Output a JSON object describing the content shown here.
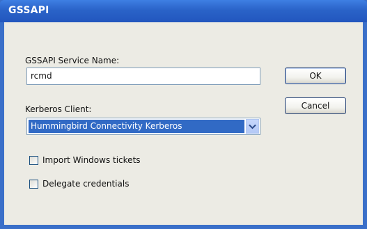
{
  "window": {
    "title": "GSSAPI"
  },
  "service_name": {
    "label": "GSSAPI Service Name:",
    "value": "rcmd"
  },
  "kerberos_client": {
    "label": "Kerberos Client:",
    "selected": "Hummingbird Connectivity Kerberos"
  },
  "buttons": {
    "ok_label": "OK",
    "cancel_label": "Cancel"
  },
  "options": {
    "import_tickets_label": "Import Windows tickets",
    "import_tickets_checked": false,
    "delegate_label": "Delegate credentials",
    "delegate_checked": false
  },
  "colors": {
    "titlebar": "#2a63c8",
    "selection": "#316ac5",
    "dialog_bg": "#ecebe4"
  },
  "icons": {
    "dropdown": "chevron-down-icon"
  }
}
